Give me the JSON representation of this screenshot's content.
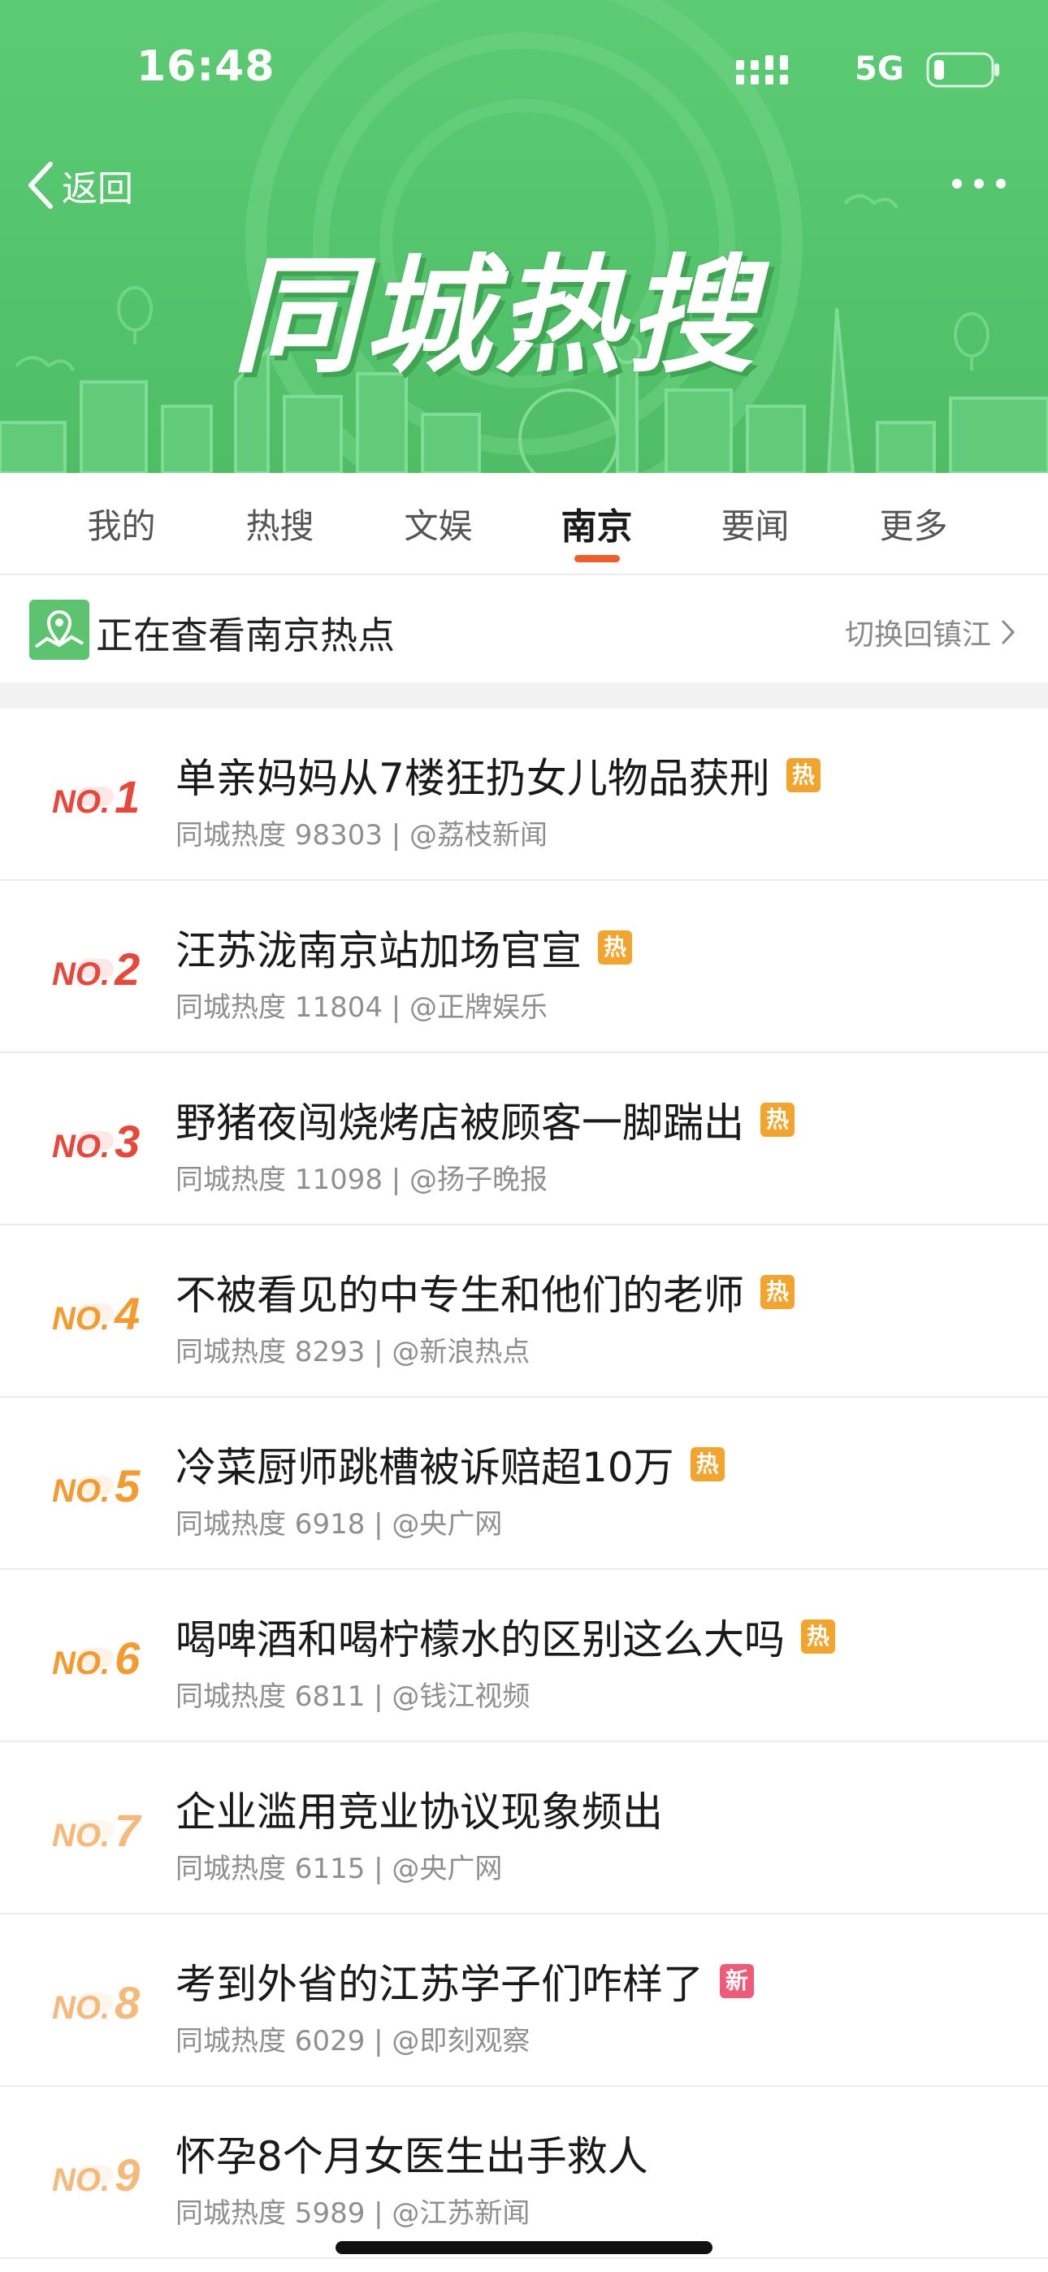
{
  "status_bar": {
    "time": "16:48",
    "network": "5G",
    "signal_icon": "signal-bars-icon",
    "battery_icon": "battery-low-icon"
  },
  "header": {
    "back_label": "返回",
    "back_icon": "chevron-left-icon",
    "more_icon": "more-dots-icon",
    "banner_title": "同城热搜",
    "banner_color": "#55c56e"
  },
  "tabs": [
    {
      "label": "我的",
      "active": false
    },
    {
      "label": "热搜",
      "active": false
    },
    {
      "label": "文娱",
      "active": false
    },
    {
      "label": "南京",
      "active": true
    },
    {
      "label": "要闻",
      "active": false
    },
    {
      "label": "更多",
      "active": false
    }
  ],
  "location": {
    "icon": "map-pin-icon",
    "text": "正在查看南京热点",
    "switch_label": "切换回镇江"
  },
  "colors": {
    "accent": "#f05c2c",
    "rank_top": "#e8473a",
    "rank_mid": "#f59a2e",
    "rank_low": "#f7b97a",
    "badge_hot": "#f3a42c",
    "badge_new": "#ef5a78"
  },
  "items": [
    {
      "no": "NO.",
      "rank": "1",
      "title": "单亲妈妈从7楼狂扔女儿物品获刑",
      "badge": "热",
      "meta": "同城热度 98303 | @荔枝新闻"
    },
    {
      "no": "NO.",
      "rank": "2",
      "title": "汪苏泷南京站加场官宣",
      "badge": "热",
      "meta": "同城热度 11804 | @正牌娱乐"
    },
    {
      "no": "NO.",
      "rank": "3",
      "title": "野猪夜闯烧烤店被顾客一脚踹出",
      "badge": "热",
      "meta": "同城热度 11098 | @扬子晚报"
    },
    {
      "no": "NO.",
      "rank": "4",
      "title": "不被看见的中专生和他们的老师",
      "badge": "热",
      "meta": "同城热度 8293 | @新浪热点"
    },
    {
      "no": "NO.",
      "rank": "5",
      "title": "冷菜厨师跳槽被诉赔超10万",
      "badge": "热",
      "meta": "同城热度 6918 | @央广网"
    },
    {
      "no": "NO.",
      "rank": "6",
      "title": "喝啤酒和喝柠檬水的区别这么大吗",
      "badge": "热",
      "meta": "同城热度 6811 | @钱江视频"
    },
    {
      "no": "NO.",
      "rank": "7",
      "title": "企业滥用竞业协议现象频出",
      "badge": "",
      "meta": "同城热度 6115 | @央广网"
    },
    {
      "no": "NO.",
      "rank": "8",
      "title": "考到外省的江苏学子们咋样了",
      "badge": "新",
      "meta": "同城热度 6029 | @即刻观察"
    },
    {
      "no": "NO.",
      "rank": "9",
      "title": "怀孕8个月女医生出手救人",
      "badge": "",
      "meta": "同城热度 5989 | @江苏新闻"
    }
  ]
}
